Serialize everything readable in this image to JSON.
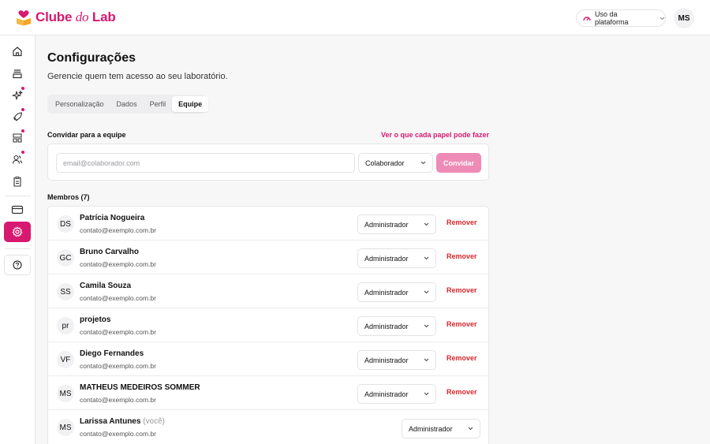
{
  "header": {
    "brand_main": "Clube ",
    "brand_italic": "do",
    "brand_end": " Lab",
    "usage_label": "Uso da plataforma",
    "user_initials": "MS",
    "brand_color": "#d7196f"
  },
  "sidebar": {
    "items": [
      {
        "icon": "home-icon"
      },
      {
        "icon": "stack-icon"
      },
      {
        "icon": "sparkles-icon",
        "badge": true
      },
      {
        "icon": "rocket-icon",
        "badge": true
      },
      {
        "icon": "layout-icon",
        "badge": true
      },
      {
        "icon": "users-icon",
        "badge": true
      },
      {
        "icon": "clipboard-icon"
      },
      {
        "icon": "card-icon"
      },
      {
        "icon": "gear-icon",
        "active": true
      },
      {
        "icon": "help-icon"
      }
    ]
  },
  "page": {
    "title": "Configurações",
    "subtitle": "Gerencie quem tem acesso ao seu laboratório."
  },
  "tabs": [
    {
      "label": "Personalização",
      "active": false
    },
    {
      "label": "Dados",
      "active": false
    },
    {
      "label": "Perfil",
      "active": false
    },
    {
      "label": "Equipe",
      "active": true
    }
  ],
  "invite": {
    "label": "Convidar para a equipe",
    "roles_link": "Ver o que cada papel pode fazer",
    "email_placeholder": "email@colaborador.com",
    "email_value": "",
    "role_value": "Colaborador",
    "button_label": "Convidar"
  },
  "members": {
    "label": "Membros (7)",
    "remove_label": "Remover",
    "you_label": "(você)",
    "list": [
      {
        "initials": "DS",
        "name": "Patrícia Nogueira",
        "email": "contato@exemplo.com.br",
        "role": "Administrador",
        "you": false
      },
      {
        "initials": "GC",
        "name": "Bruno Carvalho",
        "email": "contato@exemplo.com.br",
        "role": "Administrador",
        "you": false
      },
      {
        "initials": "SS",
        "name": "Camila Souza",
        "email": "contato@exemplo.com.br",
        "role": "Administrador",
        "you": false
      },
      {
        "initials": "pr",
        "name": "projetos",
        "email": "contato@exemplo.com.br",
        "role": "Administrador",
        "you": false
      },
      {
        "initials": "VF",
        "name": "Diego Fernandes",
        "email": "contato@exemplo.com.br",
        "role": "Administrador",
        "you": false
      },
      {
        "initials": "MS",
        "name": "MATHEUS MEDEIROS SOMMER",
        "email": "contato@exemplo.com.br",
        "role": "Administrador",
        "you": false
      },
      {
        "initials": "MS",
        "name": "Larissa Antunes",
        "email": "contato@exemplo.com.br",
        "role": "Administrador",
        "you": true
      }
    ]
  }
}
